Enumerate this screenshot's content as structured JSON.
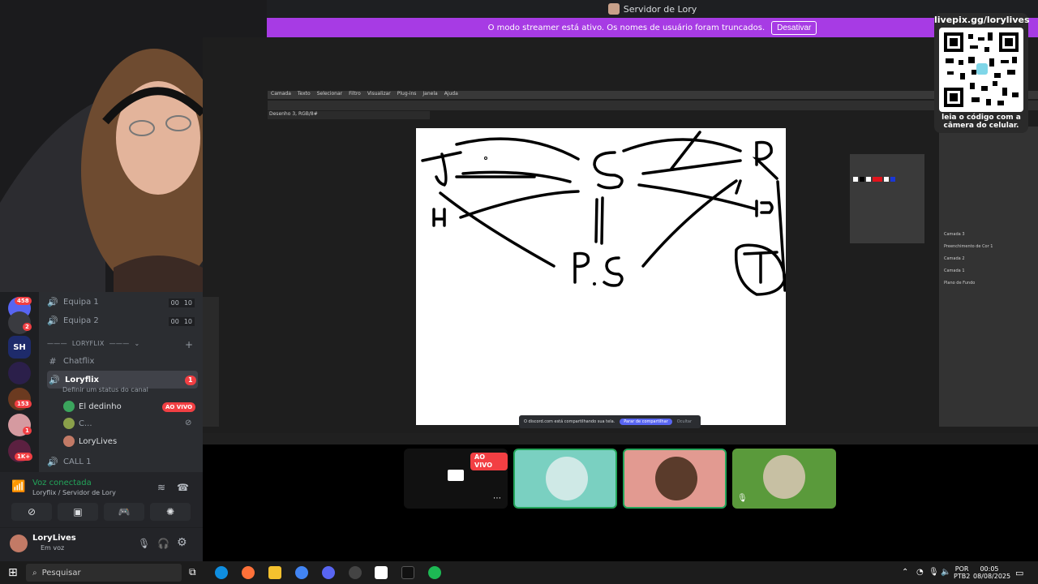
{
  "window": {
    "title": "Servidor de Lory"
  },
  "banner": {
    "text": "O modo streamer está ativo. Os nomes de usuário foram truncados.",
    "button": "Desativar"
  },
  "qr": {
    "url": "livepix.gg/lorylives",
    "caption_line1": "leia o código com a",
    "caption_line2": "câmera do celular."
  },
  "servers": {
    "badges": [
      "458",
      "2",
      "153",
      "1",
      "1K+"
    ],
    "icon_labels": [
      "SH"
    ]
  },
  "channels": {
    "equipa1": {
      "label": "Equipa 1",
      "count_left": "00",
      "count_right": "10"
    },
    "equipa2": {
      "label": "Equipa 2",
      "count_left": "00",
      "count_right": "10"
    },
    "category": "LORYFLIX",
    "chatflix": "Chatflix",
    "loryflix": {
      "label": "Loryflix",
      "badge": "1",
      "status_prompt": "Definir um status do canal"
    },
    "members": [
      {
        "name": "El dedinho",
        "badge": "AO VIVO"
      },
      {
        "name": "C..."
      },
      {
        "name": "LoryLives"
      }
    ],
    "call1": "CALL 1"
  },
  "voice": {
    "status": "Voz conectada",
    "location": "Loryflix / Servidor de Lory"
  },
  "user": {
    "name": "LoryLives",
    "status": "Em voz"
  },
  "stream": {
    "live_badge": "AO VIVO",
    "share_notice": "O discord.com está compartilhando sua tela.",
    "share_stop": "Parar de compartilhar",
    "share_hide": "Ocultar"
  },
  "photoshop": {
    "menu": [
      "Camada",
      "Texto",
      "Selecionar",
      "Filtro",
      "Visualizar",
      "Plug-ins",
      "Janela",
      "Ajuda"
    ],
    "doc_tab": "Desenho 3, RGB/8#",
    "canvas_labels": [
      "J",
      "S",
      "R",
      "H",
      "P",
      "P.S",
      "T"
    ],
    "layers": [
      "Camada 3",
      "Preenchimento de Cor 1",
      "Camada 2",
      "Camada 1",
      "Plano de Fundo"
    ]
  },
  "taskbar": {
    "search_placeholder": "Pesquisar",
    "lang_line1": "POR",
    "lang_line2": "PTB2",
    "time": "00:05",
    "date": "08/08/2025"
  },
  "colors": {
    "brand": "#5865f2",
    "streamer": "#a73be4",
    "live": "#f23f43",
    "voice": "#23a55a"
  }
}
